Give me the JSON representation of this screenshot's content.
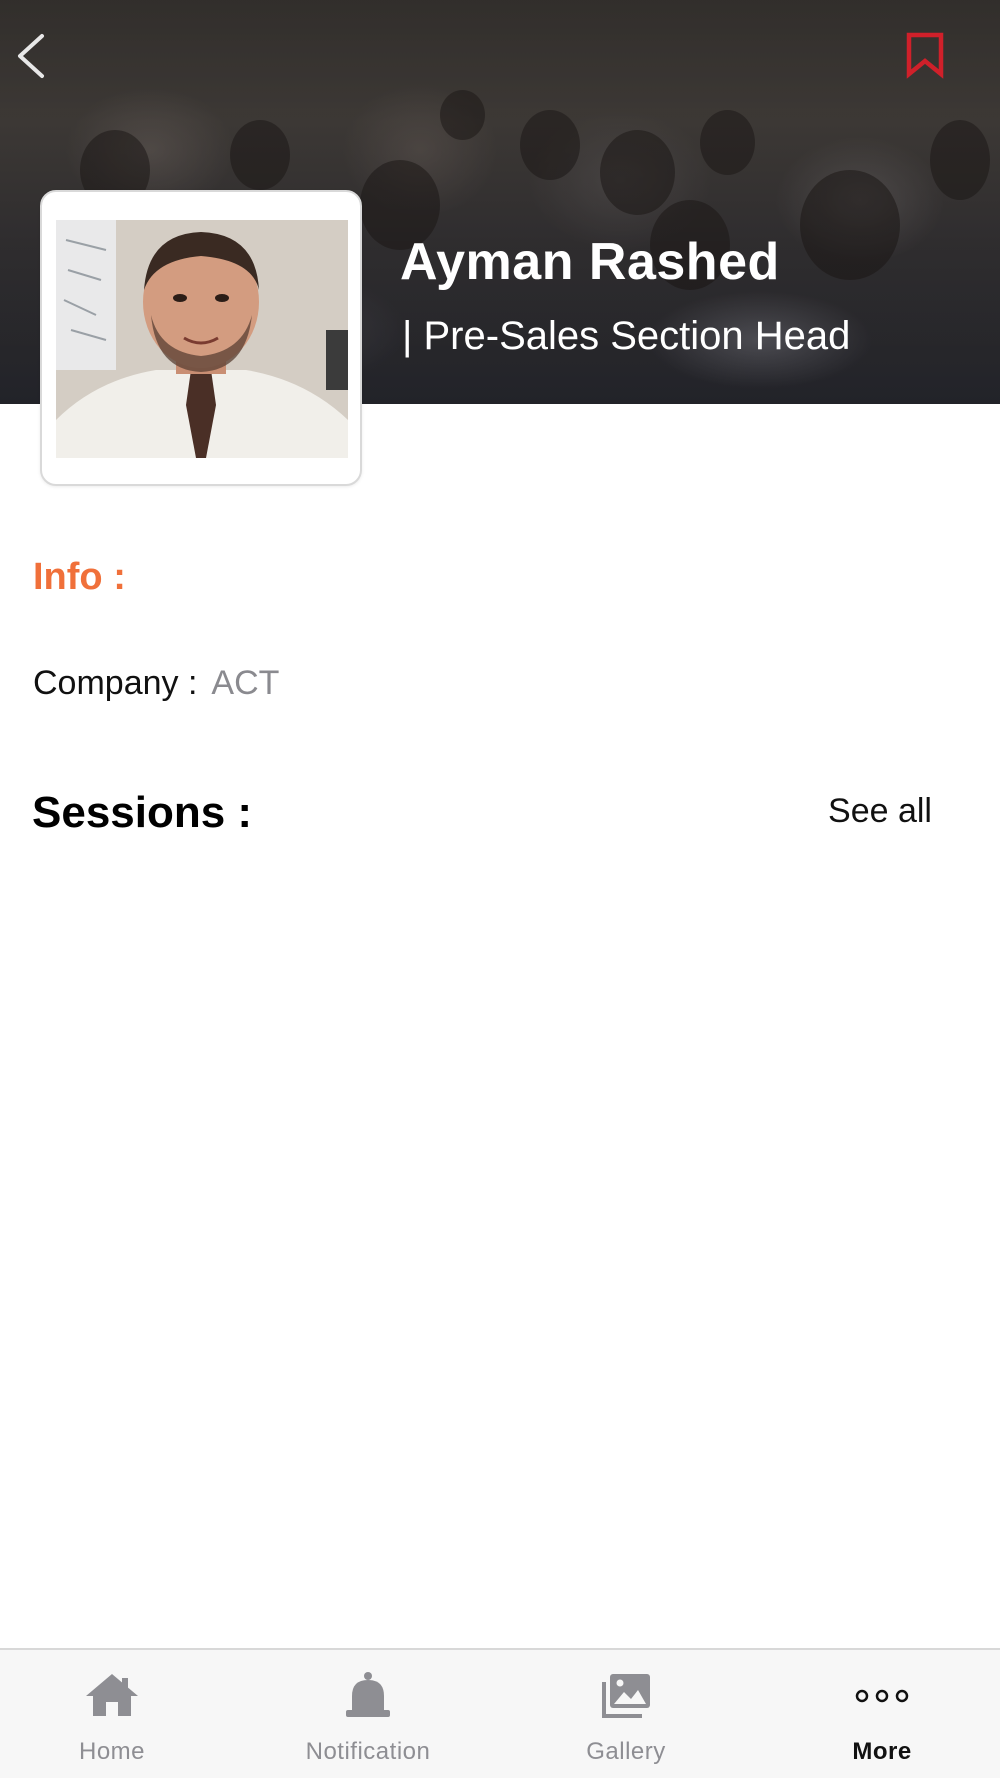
{
  "header": {
    "back_icon": "chevron-left-icon",
    "bookmark_icon": "bookmark-icon",
    "bookmark_color": "#d0202a"
  },
  "speaker": {
    "name": "Ayman Rashed",
    "title": "| Pre-Sales Section Head"
  },
  "info": {
    "heading": "Info :",
    "company_label": "Company :",
    "company_value": "ACT",
    "accent_color": "#f0703a"
  },
  "sessions": {
    "heading": "Sessions :",
    "see_all_label": "See all"
  },
  "tabbar": {
    "tabs": [
      {
        "label": "Home",
        "icon": "home-icon",
        "active": false
      },
      {
        "label": "Notification",
        "icon": "bell-icon",
        "active": false
      },
      {
        "label": "Gallery",
        "icon": "gallery-icon",
        "active": false
      },
      {
        "label": "More",
        "icon": "more-icon",
        "active": true
      }
    ]
  }
}
